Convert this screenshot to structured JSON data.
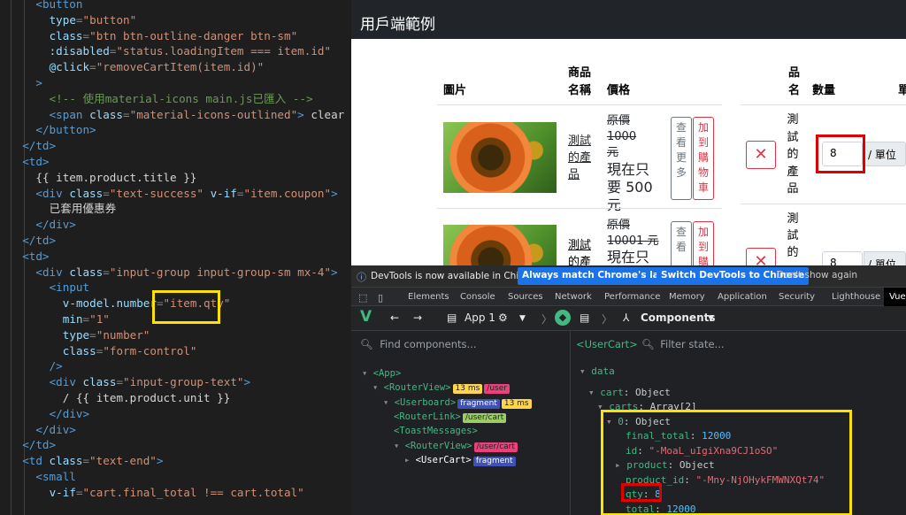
{
  "editor": {
    "lines": [
      {
        "indent": 4,
        "parts": [
          [
            "tag",
            "<button"
          ]
        ]
      },
      {
        "indent": 6,
        "parts": [
          [
            "attr",
            "type"
          ],
          [
            "pun",
            "="
          ],
          [
            "str",
            "\"button\""
          ]
        ]
      },
      {
        "indent": 6,
        "parts": [
          [
            "attr",
            "class"
          ],
          [
            "pun",
            "="
          ],
          [
            "str",
            "\"btn btn-outline-danger btn-sm\""
          ]
        ]
      },
      {
        "indent": 6,
        "parts": [
          [
            "attr",
            ":disabled"
          ],
          [
            "pun",
            "="
          ],
          [
            "str",
            "\"status.loadingItem === item.id\""
          ]
        ]
      },
      {
        "indent": 6,
        "parts": [
          [
            "attr",
            "@click"
          ],
          [
            "pun",
            "="
          ],
          [
            "str",
            "\"removeCartItem(item.id)\""
          ]
        ]
      },
      {
        "indent": 4,
        "parts": [
          [
            "tag",
            ">"
          ]
        ]
      },
      {
        "indent": 6,
        "parts": [
          [
            "cmt",
            "<!-- 使用material-icons main.js已匯入 -->"
          ]
        ]
      },
      {
        "indent": 6,
        "parts": [
          [
            "tag",
            "<span "
          ],
          [
            "attr",
            "class"
          ],
          [
            "pun",
            "="
          ],
          [
            "str",
            "\"material-icons-outlined\""
          ],
          [
            "tag",
            ">"
          ],
          [
            "txt",
            " clear "
          ],
          [
            "tag",
            "</s"
          ]
        ]
      },
      {
        "indent": 4,
        "parts": [
          [
            "tag",
            "</button>"
          ]
        ]
      },
      {
        "indent": 2,
        "parts": [
          [
            "tag",
            "</td>"
          ]
        ]
      },
      {
        "indent": 2,
        "parts": [
          [
            "tag",
            "<td>"
          ]
        ]
      },
      {
        "indent": 4,
        "parts": [
          [
            "txt",
            "{{ item.product.title }}"
          ]
        ]
      },
      {
        "indent": 4,
        "parts": [
          [
            "tag",
            "<div "
          ],
          [
            "attr",
            "class"
          ],
          [
            "pun",
            "="
          ],
          [
            "str",
            "\"text-success\" "
          ],
          [
            "attr",
            "v-if"
          ],
          [
            "pun",
            "="
          ],
          [
            "str",
            "\"item.coupon\""
          ],
          [
            "tag",
            ">"
          ]
        ]
      },
      {
        "indent": 6,
        "parts": [
          [
            "txt",
            "已套用優惠券"
          ]
        ]
      },
      {
        "indent": 4,
        "parts": [
          [
            "tag",
            "</div>"
          ]
        ]
      },
      {
        "indent": 2,
        "parts": [
          [
            "tag",
            "</td>"
          ]
        ]
      },
      {
        "indent": 2,
        "parts": [
          [
            "tag",
            "<td>"
          ]
        ]
      },
      {
        "indent": 4,
        "parts": [
          [
            "tag",
            "<div "
          ],
          [
            "attr",
            "class"
          ],
          [
            "pun",
            "="
          ],
          [
            "str",
            "\"input-group input-group-sm mx-4\""
          ],
          [
            "tag",
            ">"
          ]
        ]
      },
      {
        "indent": 6,
        "parts": [
          [
            "tag",
            "<input"
          ]
        ]
      },
      {
        "indent": 8,
        "parts": [
          [
            "attr",
            "v-model.number"
          ],
          [
            "pun",
            "="
          ],
          [
            "str",
            "\"item.qty\""
          ]
        ]
      },
      {
        "indent": 8,
        "parts": [
          [
            "attr",
            "min"
          ],
          [
            "pun",
            "="
          ],
          [
            "str",
            "\"1\""
          ]
        ]
      },
      {
        "indent": 8,
        "parts": [
          [
            "attr",
            "type"
          ],
          [
            "pun",
            "="
          ],
          [
            "str",
            "\"number\""
          ]
        ]
      },
      {
        "indent": 8,
        "parts": [
          [
            "attr",
            "class"
          ],
          [
            "pun",
            "="
          ],
          [
            "str",
            "\"form-control\""
          ]
        ]
      },
      {
        "indent": 6,
        "parts": [
          [
            "tag",
            "/>"
          ]
        ]
      },
      {
        "indent": 6,
        "parts": [
          [
            "tag",
            "<div "
          ],
          [
            "attr",
            "class"
          ],
          [
            "pun",
            "="
          ],
          [
            "str",
            "\"input-group-text\""
          ],
          [
            "tag",
            ">"
          ]
        ]
      },
      {
        "indent": 8,
        "parts": [
          [
            "txt",
            "/ {{ item.product.unit }}"
          ]
        ]
      },
      {
        "indent": 6,
        "parts": [
          [
            "tag",
            "</div>"
          ]
        ]
      },
      {
        "indent": 4,
        "parts": [
          [
            "tag",
            "</div>"
          ]
        ]
      },
      {
        "indent": 2,
        "parts": [
          [
            "tag",
            "</td>"
          ]
        ]
      },
      {
        "indent": 2,
        "parts": [
          [
            "tag",
            "<td "
          ],
          [
            "attr",
            "class"
          ],
          [
            "pun",
            "="
          ],
          [
            "str",
            "\"text-end\""
          ],
          [
            "tag",
            ">"
          ]
        ]
      },
      {
        "indent": 4,
        "parts": [
          [
            "tag",
            "<small"
          ]
        ]
      },
      {
        "indent": 6,
        "parts": [
          [
            "attr",
            "v-if"
          ],
          [
            "pun",
            "="
          ],
          [
            "str",
            "\"cart.final_total !== cart.total\""
          ]
        ]
      }
    ]
  },
  "preview": {
    "title": "用戶端範例",
    "headers": {
      "image": "圖片",
      "product_name_1": "商品",
      "product_name_2": "名稱",
      "price": "價格",
      "name_v": "品名",
      "quantity": "數量",
      "unit_cut": "單"
    },
    "row1": {
      "title_link": "測試的產品",
      "orig_price_1": "原價 1000",
      "orig_price_2": "元",
      "now_price_1": "現在只",
      "now_price_2": "要 500",
      "now_price_3": "元",
      "view_more": "查看更多",
      "add_cart": "加到購物車",
      "remove_icon": "✕",
      "cart_title": "測試的產品",
      "qty": "8",
      "unit": "/ 單位"
    },
    "row2": {
      "title_link": "測試的產",
      "orig_price_1": "原價",
      "orig_price_2": "10001 元",
      "now_price_1": "現在只",
      "view_more": "查看",
      "add_cart": "加到購",
      "cart_title": "測試的",
      "qty": "8",
      "unit": "/ 單位"
    }
  },
  "devtools": {
    "notice": {
      "message": "DevTools is now available in Chinese!",
      "btn_match": "Always match Chrome's language",
      "btn_switch": "Switch DevTools to Chinese",
      "btn_dont": "Don't show again"
    },
    "tabs": [
      "Elements",
      "Console",
      "Sources",
      "Network",
      "Performance",
      "Memory",
      "Application",
      "Security",
      "Lighthouse",
      "Vue"
    ],
    "vue_toolbar": {
      "app": "App 1",
      "components": "Components"
    },
    "search_components": "Find components...",
    "selected_component": "<UserCart>",
    "filter_state": "Filter state...",
    "tree": [
      {
        "indent": 0,
        "arrow": "▾",
        "name": "<App>",
        "badges": []
      },
      {
        "indent": 1,
        "arrow": "▾",
        "name": "<RouterView>",
        "badges": [
          [
            "b-yellow",
            "13 ms"
          ],
          [
            "b-pink",
            "/user"
          ]
        ]
      },
      {
        "indent": 2,
        "arrow": "▾",
        "name": "<Userboard>",
        "badges": [
          [
            "b-blue",
            "fragment"
          ],
          [
            "b-yellow",
            "13 ms"
          ]
        ]
      },
      {
        "indent": 3,
        "arrow": "",
        "name": "<RouterLink>",
        "badges": [
          [
            "b-green",
            "/user/cart"
          ]
        ]
      },
      {
        "indent": 3,
        "arrow": "",
        "name": "<ToastMessages>",
        "badges": []
      },
      {
        "indent": 3,
        "arrow": "▾",
        "name": "<RouterView>",
        "badges": [
          [
            "b-pink",
            "/user/cart"
          ]
        ]
      },
      {
        "indent": 4,
        "arrow": "▸",
        "name": "<UserCart>",
        "badges": [
          [
            "b-blue",
            "fragment"
          ]
        ]
      }
    ],
    "state": {
      "section": "data",
      "cart_key": "cart",
      "cart_val": "Object",
      "carts_key": "carts",
      "carts_val": "Array[2]",
      "item0_key": "0",
      "item0_val": "Object",
      "final_total_key": "final_total",
      "final_total_val": "12000",
      "id_key": "id",
      "id_val": "\"-MoaL_uIgiXna9CJ1oSO\"",
      "product_key": "product",
      "product_val": "Object",
      "product_id_key": "product_id",
      "product_id_val": "\"-Mny-NjOHykFMWNXQt74\"",
      "qty_key": "qty",
      "qty_val": "8",
      "total_key": "total",
      "total_val": "12000"
    }
  }
}
